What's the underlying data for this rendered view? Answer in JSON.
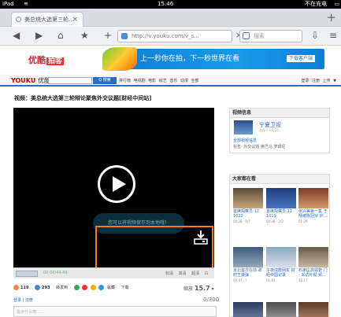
{
  "status": {
    "device": "iPad",
    "time": "15:46",
    "battery": "不在充电"
  },
  "browser": {
    "tab_title": "美总统大选第三轮...",
    "new_tab": "+",
    "url": "http://v.youku.com/v_s...",
    "search_placeholder": "搜索"
  },
  "banner": {
    "brand": "优酷",
    "brand_tag": "拍客",
    "slogan": "上一秒你在拍，下一秒世界在看",
    "download": "下载客户端"
  },
  "site": {
    "logo": "YOUKU",
    "logo_cn": "优酷",
    "search_button": "Q 搜索",
    "nav": "排行榜 电视剧 电影 综艺 音乐 动漫 全部",
    "right_links": "登录 注册 上传 ▼"
  },
  "video": {
    "title": "视频：美总统大选第三轮辩论聚焦外交议题[财经中间站]",
    "tooltip": "您可以将视频保存到本地哦！",
    "time": "00:00/44:49",
    "controls_right": "标清 高清 超清 ⊡"
  },
  "actions": {
    "up": "119",
    "down": "293",
    "share": "转发到",
    "fav": "收藏",
    "download": "下载",
    "zoom_label": "缩放",
    "zoom_value": "15.7"
  },
  "comment": {
    "link": "登录 | 注册",
    "count": "0/300",
    "placeholder": "说点什么吧......"
  },
  "sidebar": {
    "info_header": "视频信息",
    "channel_name": "宁夏卫视",
    "channel_sub": "发布于 03/22",
    "all_videos": "全部视频信息",
    "tags": "标签: 外交议题 奥巴马 罗姆尼",
    "related_header": "大家都在看",
    "cards": [
      {
        "text": "首席观察员 12 1022",
        "meta": "00:28 · 1/7"
      },
      {
        "text": "首席观察员 12 1019",
        "meta": "00:28 · 2/3"
      },
      {
        "text": "张兴美第一集 于翔被陈冠辩 护...",
        "meta": "01:29"
      },
      {
        "text": "京北首次在前 政府王援弹",
        "meta": "00:47 · 7"
      },
      {
        "text": "午夜成群网友 财经中国记录",
        "meta": "01:01"
      },
      {
        "text": "石家庄高效管 门 - 采访片视 频...",
        "meta": "15:17"
      }
    ]
  },
  "colors": {
    "accent": "#2b6fc4",
    "highlight": "#f07c1d",
    "banner": "#0b7fd6"
  }
}
